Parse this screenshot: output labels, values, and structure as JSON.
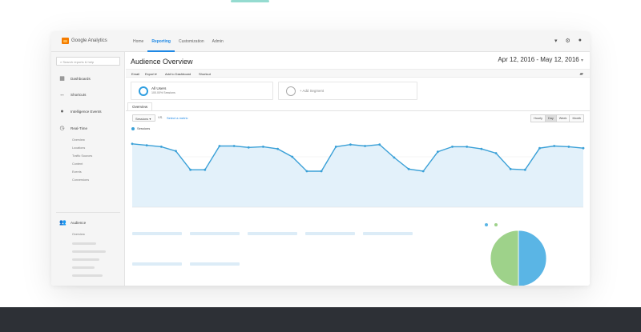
{
  "app": {
    "logo_text": "Google Analytics",
    "nav_tabs": [
      "Home",
      "Reporting",
      "Customization",
      "Admin"
    ],
    "active_tab": "Reporting",
    "header_icons": [
      "caret-down-icon",
      "gear-icon",
      "bell-icon"
    ]
  },
  "sidebar": {
    "search_placeholder": "Search reports & help",
    "items": [
      {
        "label": "Dashboards",
        "icon": "grid-icon"
      },
      {
        "label": "Shortcuts",
        "icon": "arrows-icon"
      },
      {
        "label": "Intelligence Events",
        "icon": "bulb-icon"
      },
      {
        "label": "Real-Time",
        "icon": "clock-icon"
      }
    ],
    "realtime_subitems": [
      "Overview",
      "Locations",
      "Traffic Sources",
      "Content",
      "Events",
      "Conversions"
    ],
    "audience_label": "Audience",
    "audience_subitems": [
      "Overview"
    ]
  },
  "report": {
    "title": "Audience Overview",
    "date_range": "Apr 12, 2016 - May 12, 2016",
    "toolbar": [
      "Email",
      "Export",
      "Add to Dashboard",
      "Shortcut"
    ],
    "segments": {
      "primary_name": "All Users",
      "primary_sub": "100.00% Sessions",
      "add_label": "+ Add Segment"
    },
    "tab": "Overview",
    "metric_select": "Sessions",
    "vs_label": "VS.",
    "select_metric_link": "Select a metric",
    "granularity": [
      "Hourly",
      "Day",
      "Week",
      "Month"
    ],
    "active_granularity": "Day",
    "series_label": "Sessions"
  },
  "chart_data": {
    "type": "line",
    "series": [
      {
        "name": "Sessions",
        "values": [
          88,
          86,
          84,
          78,
          52,
          52,
          85,
          85,
          83,
          84,
          81,
          70,
          50,
          50,
          84,
          87,
          85,
          87,
          69,
          53,
          50,
          77,
          84,
          84,
          81,
          75,
          53,
          52,
          82,
          85,
          84,
          82
        ]
      }
    ],
    "ylim": [
      0,
      100
    ],
    "color": "#3aa0d7",
    "fill_color": "#e3f1fa",
    "grid": true
  },
  "pie_chart": {
    "type": "pie",
    "values": [
      50,
      50
    ],
    "colors": [
      "#5ab5e5",
      "#9ed28a"
    ]
  },
  "colors": {
    "accent": "#1e88e5",
    "line": "#3aa0d7",
    "pie_blue": "#5ab5e5",
    "pie_green": "#9ed28a",
    "footer_band": "#2d3036"
  }
}
